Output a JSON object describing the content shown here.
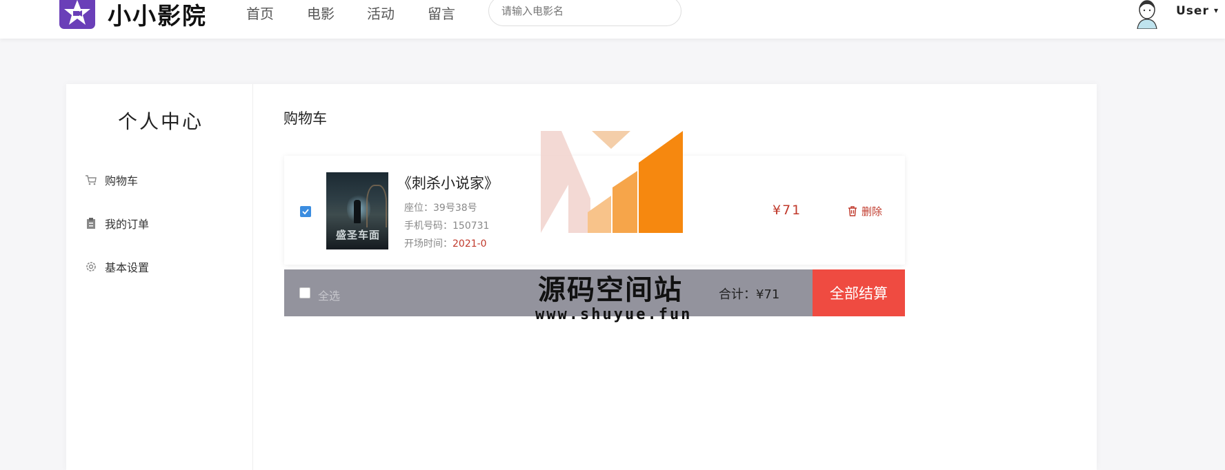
{
  "header": {
    "site_name": "小小影院",
    "nav": [
      "首页",
      "电影",
      "活动",
      "留言"
    ],
    "search_placeholder": "请输入电影名",
    "user_name": "User",
    "user_caret": "▾"
  },
  "sidebar": {
    "title": "个人中心",
    "items": [
      {
        "label": "购物车",
        "icon": "cart-icon"
      },
      {
        "label": "我的订单",
        "icon": "clipboard-icon"
      },
      {
        "label": "基本设置",
        "icon": "gear-icon"
      }
    ]
  },
  "main": {
    "section_title": "购物车",
    "cart_items": [
      {
        "checked": true,
        "poster_title": "盛圣车面",
        "title": "《刺杀小说家》",
        "seat": "座位：39号38号",
        "phone": "手机号码：150731",
        "showtime_label": "开场时间：",
        "showtime_value": "2021-0",
        "price": "¥71",
        "delete_label": "删除"
      }
    ],
    "footer": {
      "select_all_label": "全选",
      "select_all_checked": false,
      "total_label": "合计：¥71",
      "checkout_label": "全部结算"
    }
  },
  "watermark": {
    "text": "源码空间站",
    "url": "www.shuyue.fun"
  },
  "colors": {
    "brand": "#6a3fb8",
    "accent_red": "#c0392b",
    "checkout_bg": "#ef4b41",
    "checkbox_blue": "#3b8de0",
    "footer_bar": "#93939d"
  }
}
